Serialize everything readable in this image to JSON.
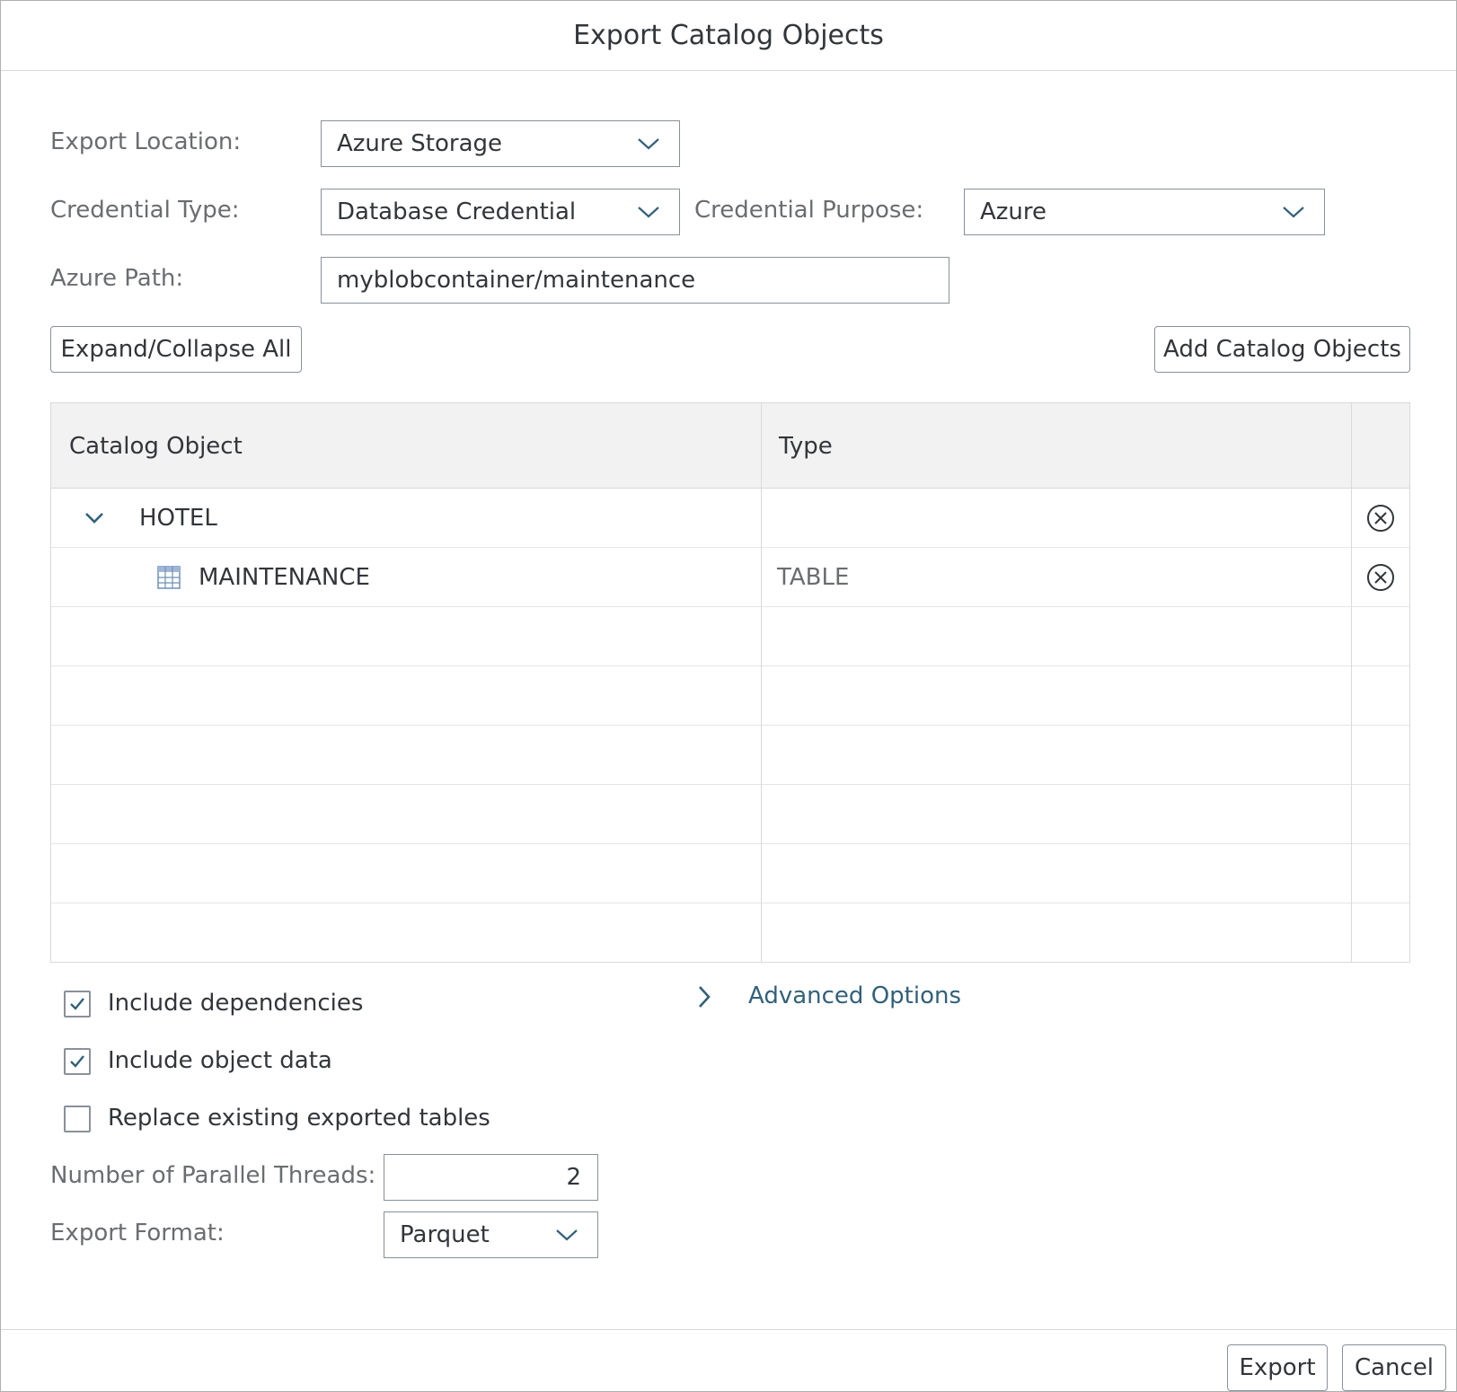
{
  "dialog": {
    "title": "Export Catalog Objects"
  },
  "form": {
    "export_location": {
      "label": "Export Location:",
      "value": "Azure Storage"
    },
    "credential_type": {
      "label": "Credential Type:",
      "value": "Database Credential"
    },
    "credential_purpose": {
      "label": "Credential Purpose:",
      "value": "Azure"
    },
    "azure_path": {
      "label": "Azure Path:",
      "value": "myblobcontainer/maintenance"
    }
  },
  "toolbar": {
    "expand_collapse_label": "Expand/Collapse All",
    "add_objects_label": "Add Catalog Objects"
  },
  "table": {
    "columns": [
      "Catalog Object",
      "Type"
    ],
    "rows": [
      {
        "name": "HOTEL",
        "type": "",
        "level": 0,
        "expanded": true
      },
      {
        "name": "MAINTENANCE",
        "type": "TABLE",
        "level": 1,
        "icon": "table-icon"
      }
    ]
  },
  "options": {
    "include_dependencies": {
      "label": "Include dependencies",
      "checked": true
    },
    "include_object_data": {
      "label": "Include object data",
      "checked": true
    },
    "replace_existing": {
      "label": "Replace existing exported tables",
      "checked": false
    },
    "advanced_label": "Advanced Options",
    "parallel_threads": {
      "label": "Number of Parallel Threads:",
      "value": "2"
    },
    "export_format": {
      "label": "Export Format:",
      "value": "Parquet"
    }
  },
  "footer": {
    "export_label": "Export",
    "cancel_label": "Cancel"
  },
  "colors": {
    "accent": "#32607a",
    "border": "#89919a",
    "header_bg": "#f2f2f2"
  }
}
